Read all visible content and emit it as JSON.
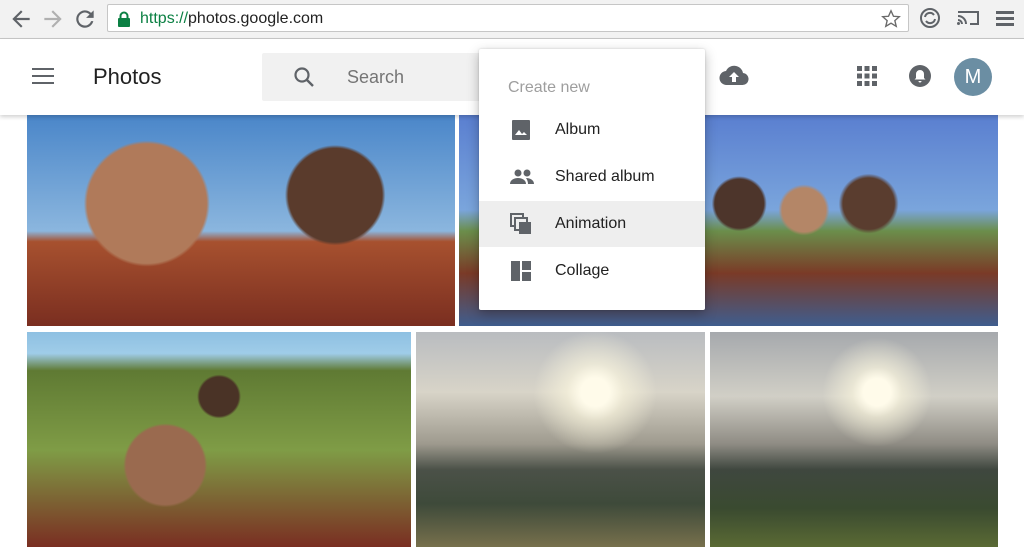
{
  "browser": {
    "url_scheme": "https://",
    "url_host": "photos.google.com"
  },
  "appbar": {
    "title": "Photos",
    "search_placeholder": "Search",
    "avatar_letter": "M"
  },
  "create_menu": {
    "header": "Create new",
    "items": [
      {
        "label": "Album",
        "icon": "album-icon",
        "active": false
      },
      {
        "label": "Shared album",
        "icon": "people-icon",
        "active": false
      },
      {
        "label": "Animation",
        "icon": "animation-icon",
        "active": true
      },
      {
        "label": "Collage",
        "icon": "collage-icon",
        "active": false
      }
    ]
  },
  "colors": {
    "secure_green": "#0b8043",
    "avatar": "#6b8ea3",
    "menu_active": "#eeeeee"
  }
}
